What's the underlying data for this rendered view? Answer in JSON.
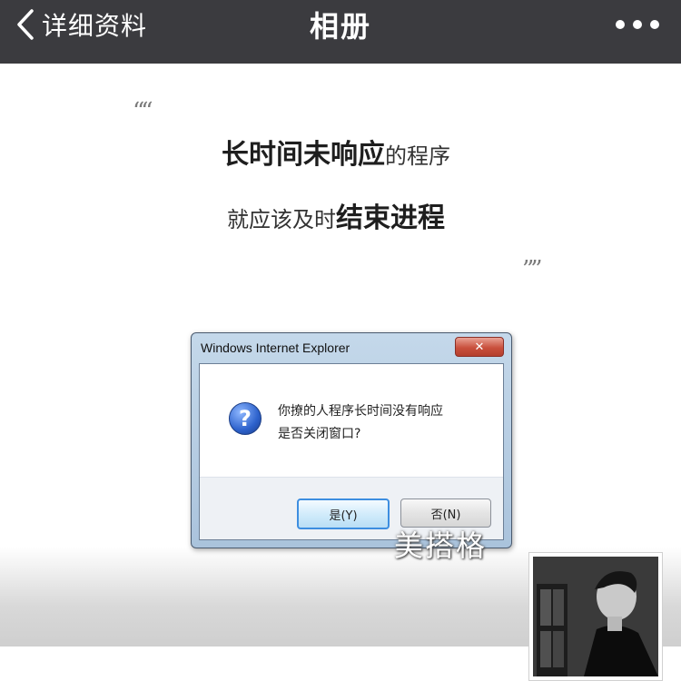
{
  "navbar": {
    "back_label": "详细资料",
    "title": "相册"
  },
  "photo": {
    "quote_open": "““",
    "quote_close": "””",
    "line1_bold": "长时间未响应",
    "line1_rest": "的程序",
    "line2_rest": "就应该及时",
    "line2_bold": "结束进程",
    "dialog": {
      "title": "Windows Internet Explorer",
      "message_line1": "你撩的人程序长时间没有响应",
      "message_line2": "是否关闭窗口?",
      "yes_label": "是(Y)",
      "no_label": "否(N)"
    }
  },
  "album": {
    "name": "美搭格"
  },
  "colors": {
    "navbar_bg": "#3b3b3f",
    "dialog_frame": "#aac3dc",
    "primary_button_border": "#3d8ee0"
  }
}
